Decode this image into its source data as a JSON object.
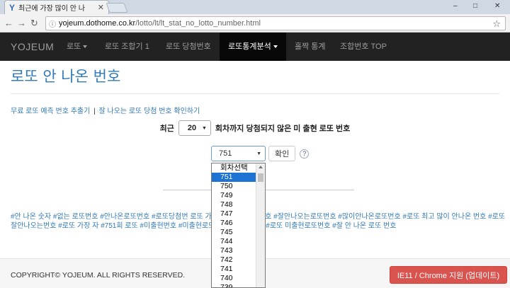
{
  "browser": {
    "tab_title": "최근에 가장 많이 안 나",
    "tab_favicon": "Y",
    "window_controls": [
      "–",
      "□",
      "✕"
    ],
    "url_host": "yojeum.dothome.co.kr",
    "url_path": "/lotto/lt/lt_stat_no_lotto_number.html"
  },
  "navbar": {
    "brand": "YOJEUM",
    "items": [
      {
        "label": "로또"
      },
      {
        "label": "로또 조합기 1"
      },
      {
        "label": "로또 당첨번호"
      },
      {
        "label": "로또통계분석"
      },
      {
        "label": "홀짝 통계"
      },
      {
        "label": "조합번호 TOP"
      }
    ]
  },
  "page": {
    "title": "로또 안 나온 번호",
    "link1": "무료 로또 예측 번호 추출기",
    "sep": "|",
    "link2": "잘 나오는 로또 당첨 번호 확인하기",
    "filter_prefix": "최근",
    "filter_value": "20",
    "filter_suffix": "회차까지 당첨되지 않은 미 출현 로또 번호",
    "round_value": "751",
    "ok_label": "확인",
    "help": "?"
  },
  "dropdown": {
    "header": "회차선택",
    "options": [
      "751",
      "750",
      "749",
      "748",
      "747",
      "746",
      "745",
      "744",
      "743",
      "742",
      "741",
      "740",
      "739"
    ]
  },
  "tags": "#안 나온 숫자 #없는 로또번호 #안나온로또번호 #로또당첨번  로또 가장 많이 안 나온 번호 #잘안나오는로또번호 #많이안나온로또번호 #로또 최고 많이 안나온 번호 #로또잘안나오는번호 #로또 가장  자 #751회 로또 #미출현번호 #미출현로또번호 #안 나온 수 #로또 미출현로또번호 #잘 안 나온 로또 번호",
  "footer": {
    "copyright": "COPYRIGHT© YOJEUM. ALL RIGHTS RESERVED.",
    "ie_button": "IE11 / Chrome 지원 (업데이트)"
  },
  "colors": {
    "accent": "#337ab7",
    "navbar": "#222222",
    "selected": "#1e73d2",
    "danger": "#d9534f"
  }
}
